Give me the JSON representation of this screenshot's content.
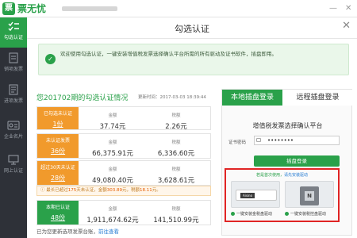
{
  "app": {
    "name": "票无忧",
    "logo_glyph": "票"
  },
  "window": {
    "minimize": "—",
    "close": "✕"
  },
  "sidebar": {
    "items": [
      {
        "label": "勾选认证",
        "icon": "checklist-icon"
      },
      {
        "label": "销项发票",
        "icon": "invoice-out-icon"
      },
      {
        "label": "进项发票",
        "icon": "invoice-in-icon"
      },
      {
        "label": "企业名片",
        "icon": "business-card-icon"
      },
      {
        "label": "网上认证",
        "icon": "online-cert-icon"
      }
    ]
  },
  "page": {
    "title": "勾选认证",
    "close": "✕"
  },
  "notice": {
    "text": "欢迎使用勾选认证，一键安装增值税发票选择确认平台所需的所有驱动及证书软件，插盘即用。"
  },
  "summary": {
    "title": "您201702期的勾选认证情况",
    "update_time": "更新时间：2017-03-03 18:39:44",
    "col_amount": "金额",
    "col_tax": "税额",
    "cards": [
      {
        "label": "已勾选未认证",
        "count": "1份",
        "amount": "37.74元",
        "tax": "2.26元",
        "color": "orange"
      },
      {
        "label": "未认证发票",
        "count": "36份",
        "amount": "66,375.91元",
        "tax": "6,336.60元",
        "color": "orange"
      },
      {
        "label": "超过30天未认证",
        "count": "28份",
        "amount": "49,080.40元",
        "tax": "3,628.61元",
        "color": "orange"
      },
      {
        "label": "本期已认证",
        "count": "48份",
        "amount": "1,911,674.62元",
        "tax": "141,510.99元",
        "color": "green"
      }
    ],
    "warning": {
      "prefix": "最长已超过",
      "days": "175",
      "mid1": "天未认证，金额",
      "amount": "303.89",
      "mid2": "元，税额",
      "tax": "18.11",
      "suffix": "元。"
    }
  },
  "bottom": {
    "text": "已为您更新选项发票台账，",
    "link": "前往查看"
  },
  "login": {
    "tab_local": "本地插盘登录",
    "tab_remote": "远程插盘登录",
    "platform_title": "增值税发票选择确认平台",
    "password_label": "证书密码",
    "password_value": "••••••••",
    "login_button": "插盘登录"
  },
  "install": {
    "hint_prefix": "若是首次使用，",
    "hint_link": "请先安装驱动",
    "left_label": "一键安装金税盘驱动",
    "right_label": "一键安装税控盘驱动",
    "left_disk_tag": "Aisino"
  },
  "colors": {
    "brand_green": "#2aa14a",
    "badge_orange": "#f19a2c",
    "highlight_red": "#e02424"
  }
}
